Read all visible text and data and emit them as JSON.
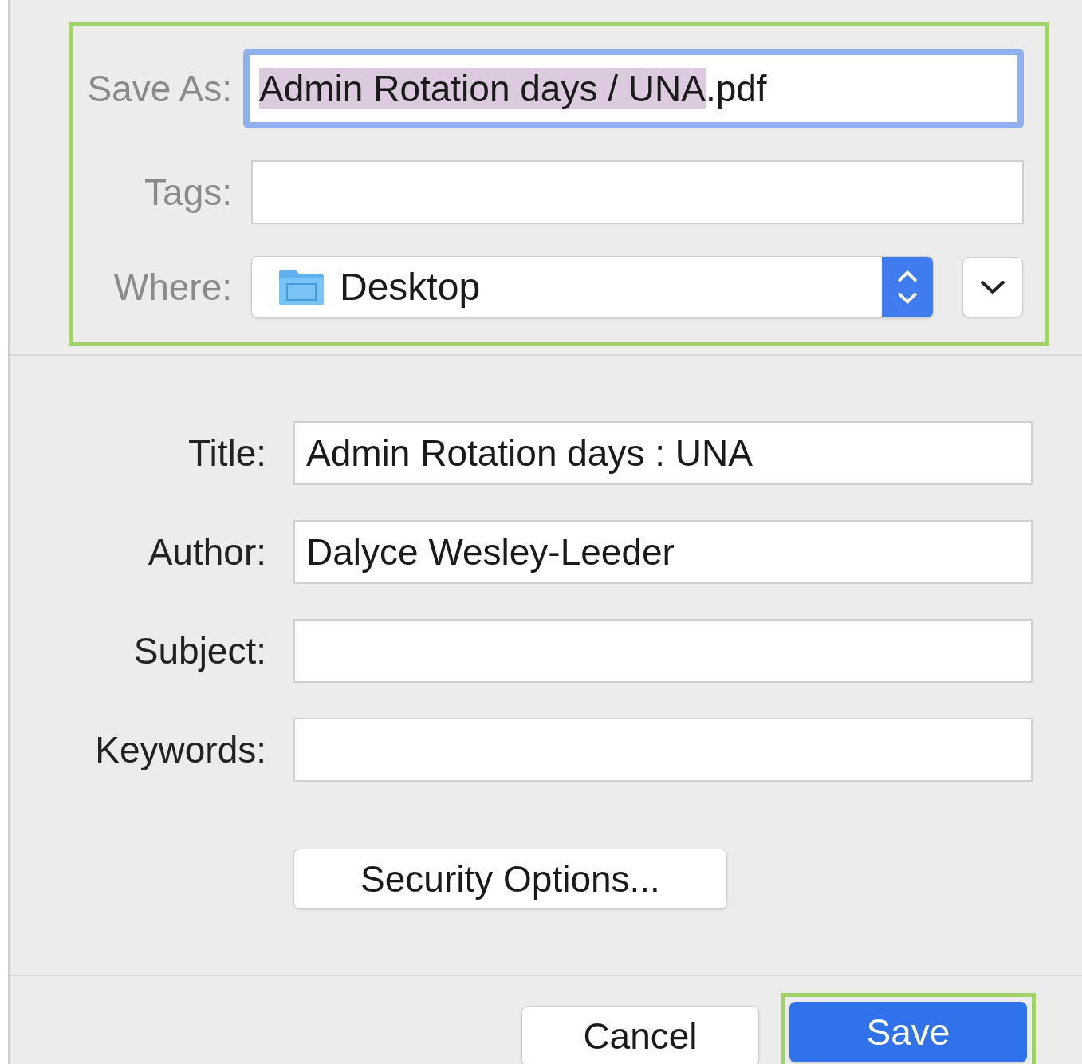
{
  "save_section": {
    "highlighted": true,
    "save_as": {
      "label": "Save As:",
      "value_selected": "Admin Rotation days / UNA",
      "value_rest": ".pdf",
      "focused": true
    },
    "tags": {
      "label": "Tags:"
    },
    "where": {
      "label": "Where:",
      "value": "Desktop"
    }
  },
  "metadata": [
    {
      "label": "Title:",
      "value": "Admin Rotation days : UNA"
    },
    {
      "label": "Author:",
      "value": "Dalyce Wesley-Leeder"
    },
    {
      "label": "Subject:"
    },
    {
      "label": "Keywords:"
    }
  ],
  "security_button": "Security Options...",
  "buttons": [
    {
      "label": "Cancel",
      "kind": "secondary",
      "highlighted": false
    },
    {
      "label": "Save",
      "kind": "primary",
      "highlighted": true
    }
  ]
}
